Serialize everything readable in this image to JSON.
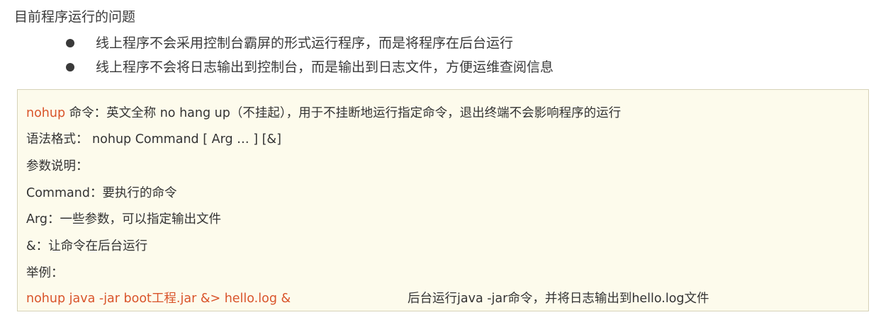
{
  "title": "目前程序运行的问题",
  "bullets": [
    "线上程序不会采用控制台霸屏的形式运行程序，而是将程序在后台运行",
    "线上程序不会将日志输出到控制台，而是输出到日志文件，方便运维查阅信息"
  ],
  "box": {
    "line1_keyword": "nohup",
    "line1_text": " 命令：英文全称 no hang up（不挂起），用于不挂断地运行指定命令，退出终端不会影响程序的运行",
    "syntax": "语法格式： nohup Command [ Arg … ] [&]",
    "params_heading": "参数说明：",
    "param_command": "Command：要执行的命令",
    "param_arg": "Arg：一些参数，可以指定输出文件",
    "param_amp": "&：让命令在后台运行",
    "example_heading": "举例：",
    "example_command": "nohup java -jar boot工程.jar &> hello.log  &",
    "example_note": "后台运行java -jar命令，并将日志输出到hello.log文件"
  },
  "colors": {
    "accent": "#d9542a",
    "box_background": "#fdfbec",
    "box_border": "#d6d2b8"
  }
}
